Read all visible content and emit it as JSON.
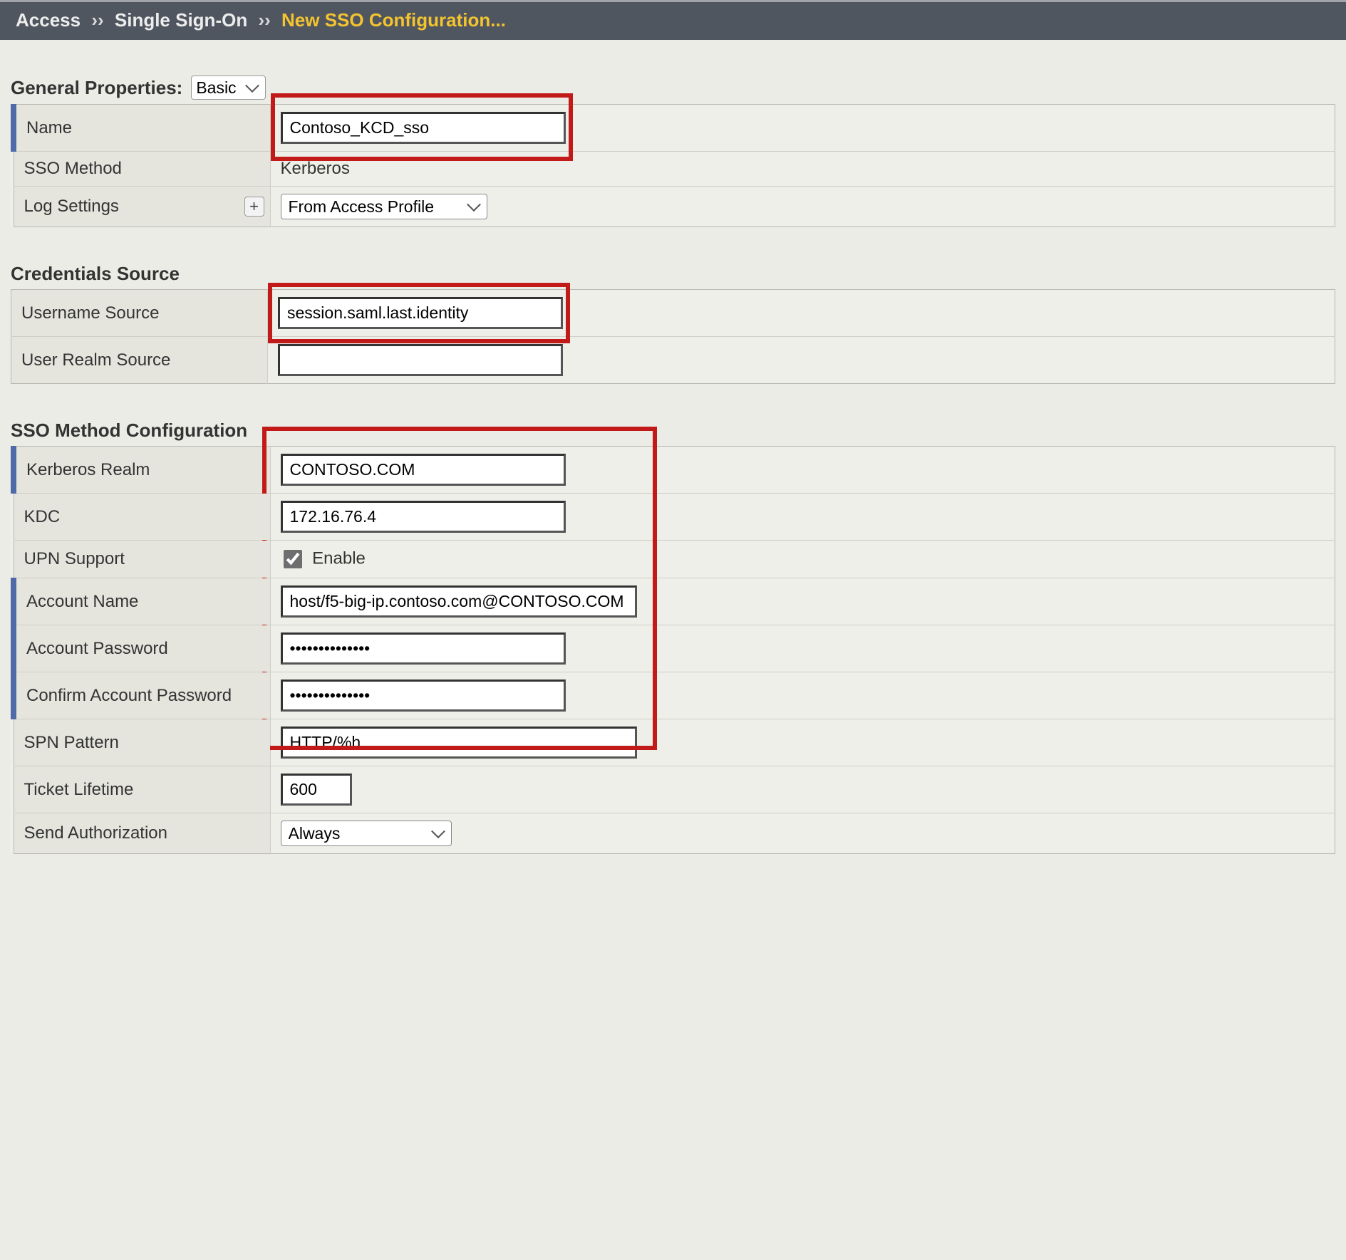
{
  "breadcrumb": {
    "root": "Access",
    "mid": "Single Sign-On",
    "current": "New SSO Configuration..."
  },
  "sections": {
    "general": {
      "title": "General Properties:",
      "mode_value": "Basic"
    },
    "credentials": {
      "title": "Credentials Source"
    },
    "sso_method": {
      "title": "SSO Method Configuration"
    }
  },
  "fields": {
    "name": {
      "label": "Name",
      "value": "Contoso_KCD_sso"
    },
    "sso_method": {
      "label": "SSO Method",
      "value": "Kerberos"
    },
    "log_settings": {
      "label": "Log Settings",
      "value": "From Access Profile",
      "plus": "+"
    },
    "username_source": {
      "label": "Username Source",
      "value": "session.saml.last.identity"
    },
    "user_realm_source": {
      "label": "User Realm Source",
      "value": ""
    },
    "kerberos_realm": {
      "label": "Kerberos Realm",
      "value": "CONTOSO.COM"
    },
    "kdc": {
      "label": "KDC",
      "value": "172.16.76.4"
    },
    "upn_support": {
      "label": "UPN Support",
      "enable_label": "Enable",
      "checked": true
    },
    "account_name": {
      "label": "Account Name",
      "value": "host/f5-big-ip.contoso.com@CONTOSO.COM"
    },
    "account_password": {
      "label": "Account Password",
      "value": "••••••••••••••"
    },
    "confirm_account_password": {
      "label": "Confirm Account Password",
      "value": "••••••••••••••"
    },
    "spn_pattern": {
      "label": "SPN Pattern",
      "value": "HTTP/%h"
    },
    "ticket_lifetime": {
      "label": "Ticket Lifetime",
      "value": "600"
    },
    "send_authorization": {
      "label": "Send Authorization",
      "value": "Always"
    }
  }
}
